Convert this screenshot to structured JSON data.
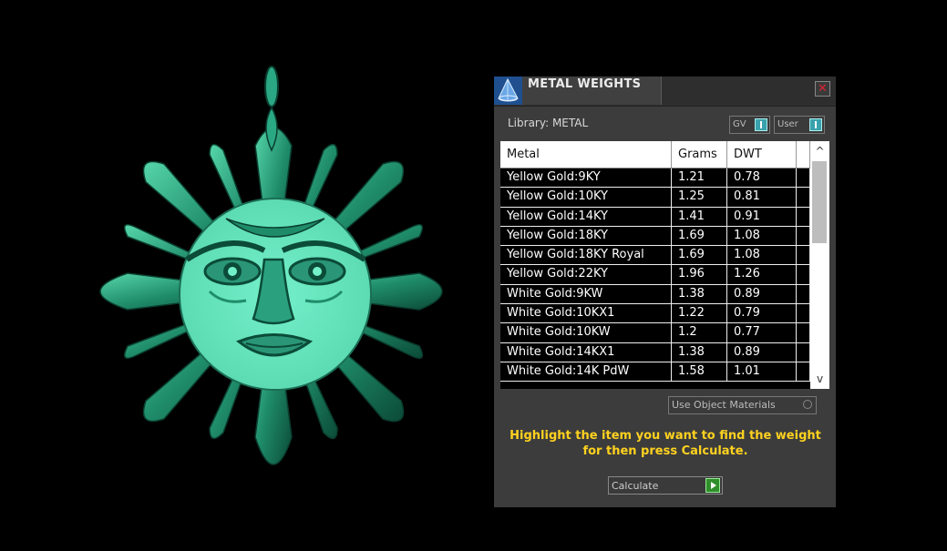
{
  "panel": {
    "title": "METAL WEIGHTS",
    "close_symbol": "✕",
    "library_label": "Library: METAL",
    "toggle_gv": "GV",
    "toggle_user": "User"
  },
  "table": {
    "headers": [
      "Metal",
      "Grams",
      "DWT"
    ],
    "rows": [
      {
        "metal": "Yellow Gold:9KY",
        "grams": "1.21",
        "dwt": "0.78"
      },
      {
        "metal": "Yellow Gold:10KY",
        "grams": "1.25",
        "dwt": "0.81"
      },
      {
        "metal": "Yellow Gold:14KY",
        "grams": "1.41",
        "dwt": "0.91"
      },
      {
        "metal": "Yellow Gold:18KY",
        "grams": "1.69",
        "dwt": "1.08"
      },
      {
        "metal": "Yellow Gold:18KY Royal",
        "grams": "1.69",
        "dwt": "1.08"
      },
      {
        "metal": "Yellow Gold:22KY",
        "grams": "1.96",
        "dwt": "1.26"
      },
      {
        "metal": "White Gold:9KW",
        "grams": "1.38",
        "dwt": "0.89"
      },
      {
        "metal": "White Gold:10KX1",
        "grams": "1.22",
        "dwt": "0.79"
      },
      {
        "metal": "White Gold:10KW",
        "grams": "1.2",
        "dwt": "0.77"
      },
      {
        "metal": "White Gold:14KX1",
        "grams": "1.38",
        "dwt": "0.89"
      },
      {
        "metal": "White Gold:14K PdW",
        "grams": "1.58",
        "dwt": "1.01"
      }
    ],
    "scroll_up": "^",
    "scroll_down": "v"
  },
  "use_object_materials": "Use Object Materials",
  "hint": "Highlight the item you want to find the weight for then press Calculate.",
  "calculate_label": "Calculate",
  "colors": {
    "accent_teal": "#3aa2ad",
    "hint_yellow": "#ffd21f",
    "play_green": "#2f8f2a",
    "sun_light": "#6ee8c2",
    "sun_dark": "#1d8a68"
  }
}
